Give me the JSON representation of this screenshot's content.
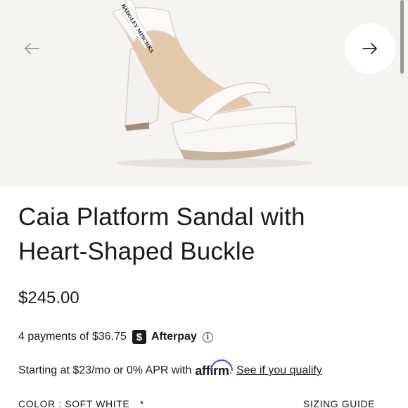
{
  "product": {
    "title_line1": "Caia Platform Sandal with",
    "title_line2": "Heart-Shaped Buckle",
    "price": "$245.00"
  },
  "afterpay": {
    "text": "4 payments of $36.75",
    "badge": "$",
    "brand": "Afterpay",
    "info_icon": "info-icon"
  },
  "affirm": {
    "text": "Starting at $23/mo or 0% APR with",
    "brand": "affirm",
    "period": ".",
    "link": "See if you qualify"
  },
  "options": {
    "color_label": "COLOR : SOFT WHITE",
    "required_mark": "*",
    "sizing_guide": "SIZING GUIDE"
  },
  "gallery": {
    "prev_icon": "arrow-left-icon",
    "next_icon": "arrow-right-icon",
    "label_text": "BADGLEY MISCHKA"
  },
  "colors": {
    "background": "#f5f4f1",
    "text": "#1a1a1a",
    "affirm_accent": "#4a4af4"
  }
}
